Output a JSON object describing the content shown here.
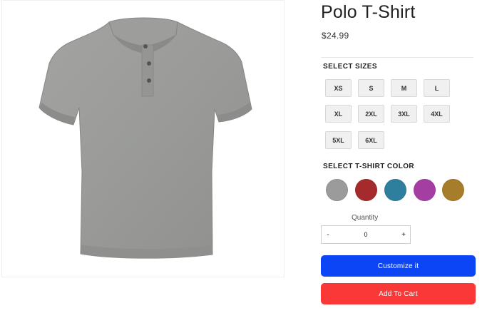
{
  "product": {
    "title": "Polo T-Shirt",
    "price": "$24.99",
    "image_alt": "grey polo t-shirt"
  },
  "sizes": {
    "label": "SELECT SIZES",
    "options": [
      "XS",
      "S",
      "M",
      "L",
      "XL",
      "2XL",
      "3XL",
      "4XL",
      "5XL",
      "6XL"
    ]
  },
  "colors": {
    "label": "SELECT T-SHIRT COLOR",
    "options": [
      "#9a9b9a",
      "#a52a2b",
      "#2e7f9d",
      "#a43ea3",
      "#a67d2a"
    ]
  },
  "quantity": {
    "label": "Quantity",
    "minus": "-",
    "value": "0",
    "plus": "+"
  },
  "actions": {
    "customize": "Customize it",
    "add_to_cart": "Add To Cart",
    "customize_color": "#0c45f6",
    "cart_color": "#fa3838"
  }
}
